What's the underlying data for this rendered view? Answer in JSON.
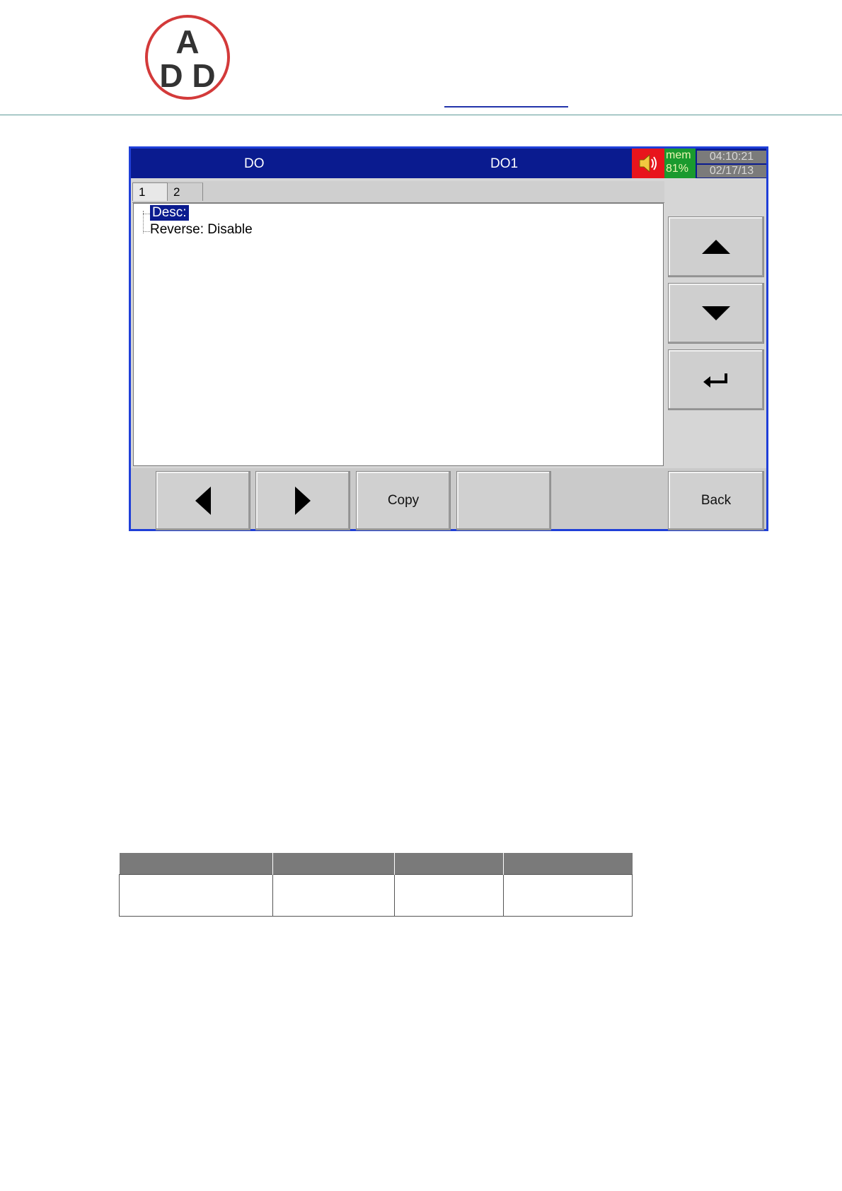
{
  "screen": {
    "title_mode": "DO",
    "title_channel": "DO1",
    "mem_label": "mem",
    "mem_value": "81%",
    "time": "04:10:21",
    "date": "02/17/13",
    "tabs": [
      {
        "label": "1"
      },
      {
        "label": "2"
      }
    ],
    "items": [
      {
        "text": "Desc:"
      },
      {
        "text": "Reverse: Disable"
      }
    ],
    "buttons": {
      "copy": "Copy",
      "back": "Back"
    },
    "icons": {
      "speaker": "speaker-icon",
      "up": "arrow-up-icon",
      "down": "arrow-down-icon",
      "enter": "enter-icon",
      "left": "arrow-left-icon",
      "right": "arrow-right-icon"
    }
  },
  "colors": {
    "titlebar": "#0a1b8f",
    "alarm": "#e8141c",
    "mem": "#1a9a2e",
    "logo_ring": "#d33a3a"
  },
  "logo": {
    "text_top": "A",
    "text_left": "D",
    "text_right": "D"
  },
  "table": {
    "columns": 4
  }
}
